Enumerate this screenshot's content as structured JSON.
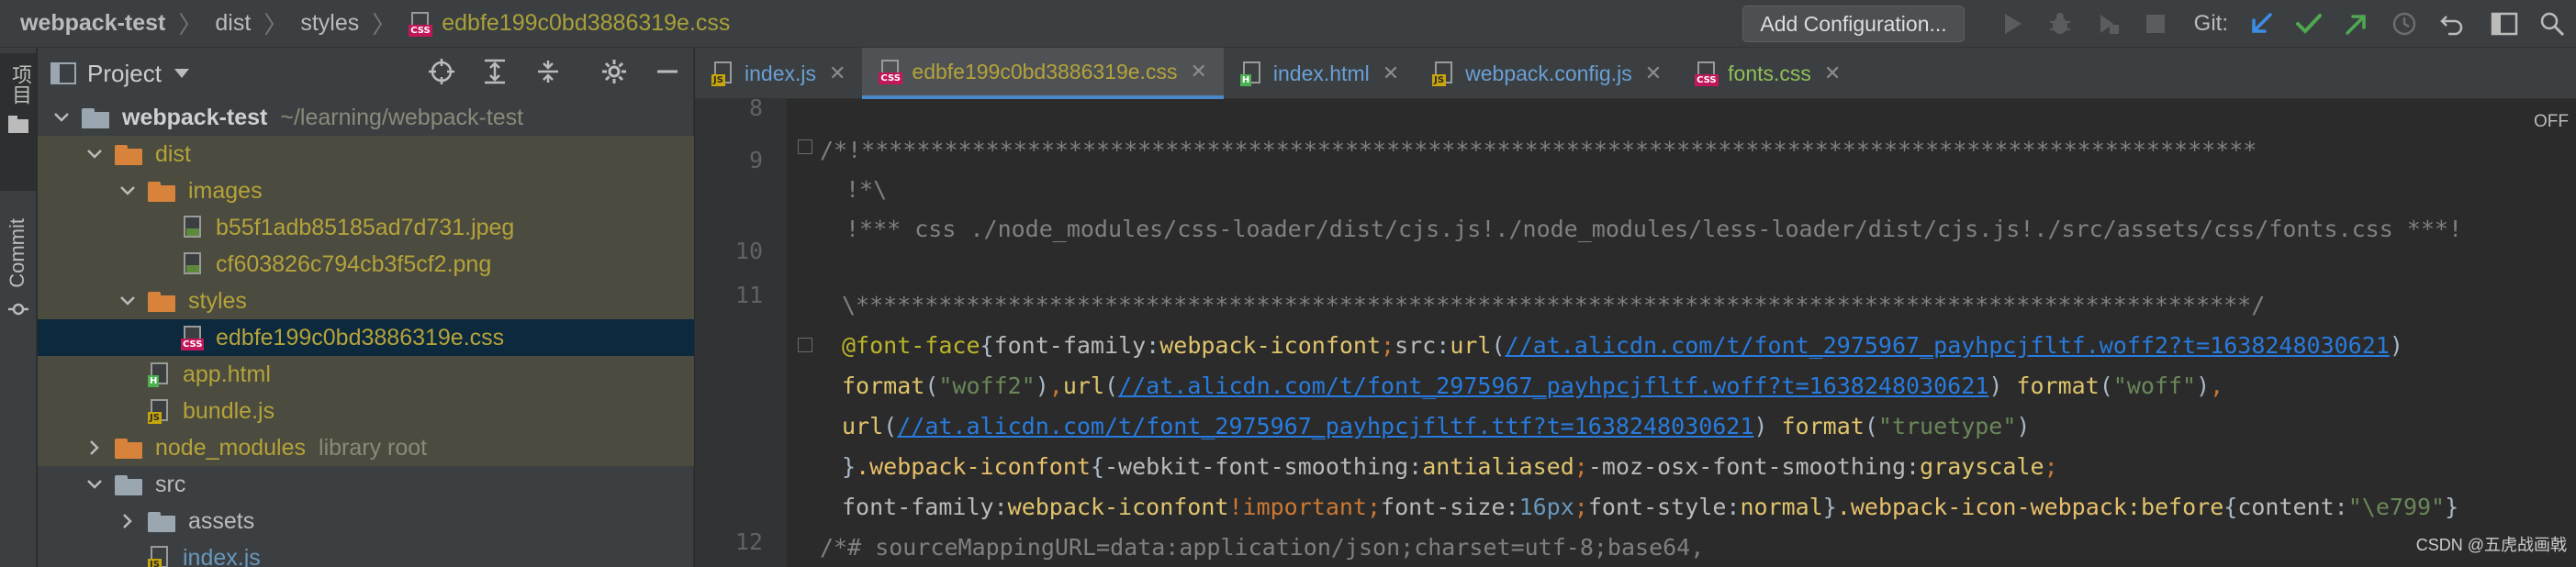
{
  "breadcrumb": {
    "project": "webpack-test",
    "dir1": "dist",
    "dir2": "styles",
    "file": "edbfe199c0bd3886319e.css",
    "file_icon": "css-file-icon"
  },
  "toolbar": {
    "add_configuration": "Add Configuration...",
    "git_label": "Git:",
    "icons": [
      "run-icon",
      "debug-icon",
      "coverage-icon",
      "stop-icon",
      "git-update-icon",
      "git-commit-icon",
      "git-push-icon",
      "history-icon",
      "rollback-icon",
      "layout-icon",
      "search-icon"
    ]
  },
  "left_strip": {
    "project_tab": "项目",
    "commit_tab": "Commit"
  },
  "project_panel": {
    "title": "Project",
    "tools": [
      "locate-icon",
      "expand-all-icon",
      "collapse-all-icon",
      "settings-icon",
      "hide-icon"
    ],
    "tree": [
      {
        "id": "root",
        "label": "webpack-test",
        "path": "~/learning/webpack-test",
        "type": "folder-grey",
        "depth": 0,
        "expanded": true
      },
      {
        "id": "dist",
        "label": "dist",
        "type": "folder-orange",
        "depth": 1,
        "expanded": true,
        "excluded": true
      },
      {
        "id": "images",
        "label": "images",
        "type": "folder-orange",
        "depth": 2,
        "expanded": true,
        "excluded": true
      },
      {
        "id": "jpeg",
        "label": "b55f1adb85185ad7d731.jpeg",
        "type": "file-img",
        "depth": 3,
        "excluded": true
      },
      {
        "id": "png",
        "label": "cf603826c794cb3f5cf2.png",
        "type": "file-img",
        "depth": 3,
        "excluded": true
      },
      {
        "id": "styles",
        "label": "styles",
        "type": "folder-orange",
        "depth": 2,
        "expanded": true,
        "excluded": true
      },
      {
        "id": "css",
        "label": "edbfe199c0bd3886319e.css",
        "type": "file-css",
        "depth": 3,
        "selected": true
      },
      {
        "id": "apphtml",
        "label": "app.html",
        "type": "file-html",
        "depth": 2,
        "excluded": true
      },
      {
        "id": "bundle",
        "label": "bundle.js",
        "type": "file-js",
        "depth": 2,
        "excluded": true
      },
      {
        "id": "nm",
        "label": "node_modules",
        "suffix": "library root",
        "type": "folder-orange",
        "depth": 1,
        "expanded": false,
        "excluded": true
      },
      {
        "id": "src",
        "label": "src",
        "type": "folder-grey",
        "depth": 1,
        "expanded": true
      },
      {
        "id": "assets",
        "label": "assets",
        "type": "folder-grey",
        "depth": 2,
        "expanded": false
      },
      {
        "id": "indexjs",
        "label": "index.js",
        "type": "file-js",
        "depth": 2
      }
    ]
  },
  "tabs": [
    {
      "label": "index.js",
      "type": "js",
      "color": "blue"
    },
    {
      "label": "edbfe199c0bd3886319e.css",
      "type": "css",
      "color": "yellow",
      "active": true
    },
    {
      "label": "index.html",
      "type": "html",
      "color": "blue"
    },
    {
      "label": "webpack.config.js",
      "type": "js",
      "color": "blue"
    },
    {
      "label": "fonts.css",
      "type": "css",
      "color": "green"
    }
  ],
  "editor": {
    "line_numbers": [
      "8",
      "9",
      "10",
      "11",
      "12"
    ],
    "off_label": "OFF",
    "code": {
      "l9": "/*!*****************************************************************************************************",
      "l9b": "!*\\",
      "l10": "!*** css ./node_modules/css-loader/dist/cjs.js!./node_modules/less-loader/dist/cjs.js!./src/assets/css/fonts.css ***!",
      "l11": "\\*****************************************************************************************************/",
      "ff_at": "@font-face",
      "ff_open": "{",
      "ff_prop1": "font-family",
      "ff_val1": "webpack-iconfont",
      "ff_prop2": "src",
      "url_fn": "url",
      "url1": "//at.alicdn.com/t/font_2975967_payhpcjfltf.woff2?t=1638248030621",
      "format_fn": "format",
      "fmt1": "\"woff2\"",
      "url2": "//at.alicdn.com/t/font_2975967_payhpcjfltf.woff?t=1638248030621",
      "fmt2": "\"woff\"",
      "url3": "//at.alicdn.com/t/font_2975967_payhpcjfltf.ttf?t=1638248030621",
      "fmt3": "\"truetype\"",
      "sel1": ".webpack-iconfont",
      "prop_smooth": "-webkit-font-smoothing",
      "val_smooth": "antialiased",
      "prop_osx": "-moz-osx-font-smoothing",
      "val_osx": "grayscale",
      "prop_ff": "font-family",
      "val_ff": "webpack-iconfont",
      "important": "!important",
      "prop_fs": "font-size",
      "val_fs": "16px",
      "prop_fst": "font-style",
      "val_fst": "normal",
      "sel2": ".webpack-icon-webpack",
      "pseudo": ":before",
      "prop_content": "content",
      "val_content": "\"\\e799\"",
      "l12": "/*# sourceMappingURL=data:application/json;charset=utf-8;base64,"
    }
  },
  "watermark": "CSDN @五虎战画戟",
  "colors": {
    "background": "#2b2b2b",
    "panel": "#3c3f41",
    "selection": "#0d293e",
    "excluded": "#4b4b3f",
    "accent": "#4a88c7"
  }
}
